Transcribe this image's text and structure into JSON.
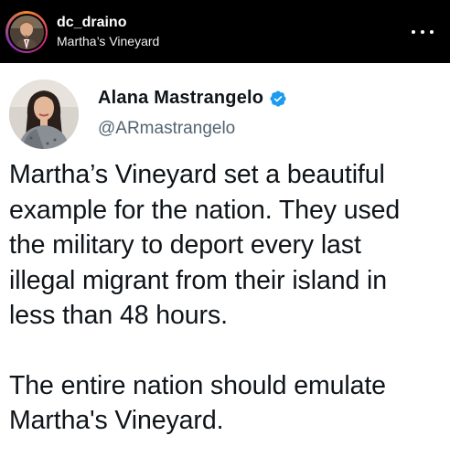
{
  "post_header": {
    "username": "dc_draino",
    "location": "Martha’s Vineyard",
    "more_icon": "more-horizontal-icon"
  },
  "tweet": {
    "author_name": "Alana Mastrangelo",
    "verified_icon": "verified-badge-icon",
    "handle": "@ARmastrangelo",
    "paragraph1_lines": [
      "Martha’s Vineyard set a beautiful",
      "example for the nation. They used",
      "the military to deport every last",
      "illegal migrant from their island in",
      "less than 48 hours."
    ],
    "paragraph2_lines": [
      "The entire nation should emulate",
      "Martha's Vineyard."
    ]
  },
  "colors": {
    "header_bg": "#000000",
    "verified_blue": "#1d9bf0",
    "handle_gray": "#536471",
    "text": "#0f1419"
  }
}
